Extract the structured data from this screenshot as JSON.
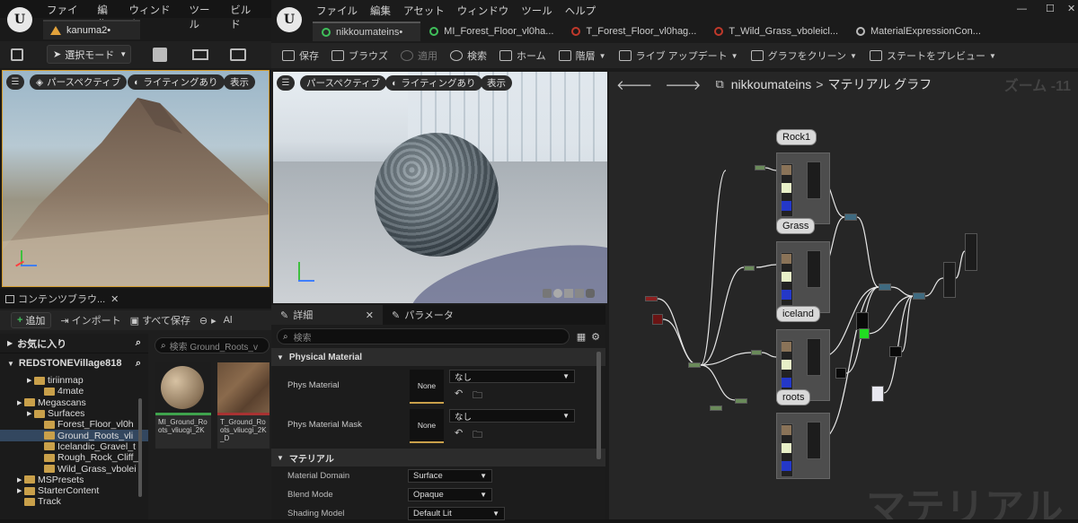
{
  "left_window": {
    "menu": [
      "ファイル",
      "編集",
      "ウィンドウ",
      "ツール",
      "ビルド"
    ],
    "tab_title": "kanuma2•",
    "toolbar": {
      "mode_label": "選択モード"
    },
    "viewport": {
      "perspective": "パースペクティブ",
      "lighting": "ライティングあり",
      "show": "表示"
    }
  },
  "content_browser": {
    "tab_label": "コンテンツブラウ...",
    "add_label": "追加",
    "import_label": "インポート",
    "save_all_label": "すべて保存",
    "path_label": "Al",
    "favorites_label": "お気に入り",
    "project_label": "REDSTONEVillage818",
    "search_placeholder": "検索 Ground_Roots_v",
    "tree": [
      {
        "label": "tiriinmap",
        "indent": 2,
        "selected": false
      },
      {
        "label": "4mate",
        "indent": 3,
        "selected": false
      },
      {
        "label": "Megascans",
        "indent": 1,
        "selected": false
      },
      {
        "label": "Surfaces",
        "indent": 2,
        "selected": false
      },
      {
        "label": "Forest_Floor_vl0h",
        "indent": 3,
        "selected": false
      },
      {
        "label": "Ground_Roots_vli",
        "indent": 3,
        "selected": true
      },
      {
        "label": "Icelandic_Gravel_t",
        "indent": 3,
        "selected": false
      },
      {
        "label": "Rough_Rock_Cliff_",
        "indent": 3,
        "selected": false
      },
      {
        "label": "Wild_Grass_vbolei",
        "indent": 3,
        "selected": false
      },
      {
        "label": "MSPresets",
        "indent": 1,
        "selected": false
      },
      {
        "label": "StarterContent",
        "indent": 1,
        "selected": false
      },
      {
        "label": "Track",
        "indent": 1,
        "selected": false
      }
    ],
    "assets": [
      {
        "name": "MI_Ground_Roots_vliucgi_2K",
        "color": "#3fa34d"
      },
      {
        "name": "T_Ground_Roots_vliucgi_2K_D",
        "color": "#a83232"
      }
    ]
  },
  "right_window": {
    "menu": [
      "ファイル",
      "編集",
      "アセット",
      "ウィンドウ",
      "ツール",
      "ヘルプ"
    ],
    "tabs": [
      {
        "label": "nikkoumateins•",
        "active": true,
        "icon": "material-icon",
        "color": "#3fbf5a"
      },
      {
        "label": "MI_Forest_Floor_vl0ha...",
        "active": false,
        "icon": "material-instance-icon",
        "color": "#3fbf5a"
      },
      {
        "label": "T_Forest_Floor_vl0hag...",
        "active": false,
        "icon": "texture-icon",
        "color": "#c0392b"
      },
      {
        "label": "T_Wild_Grass_vboleicl...",
        "active": false,
        "icon": "texture-icon",
        "color": "#c0392b"
      },
      {
        "label": "MaterialExpressionCon...",
        "active": false,
        "icon": "expression-icon",
        "color": "#bbbbbb"
      }
    ],
    "toolbar": [
      "保存",
      "ブラウズ",
      "適用",
      "検索",
      "ホーム",
      "階層",
      "ライブ アップデート",
      "グラフをクリーン",
      "ステートをプレビュー"
    ],
    "preview": {
      "perspective": "パースペクティブ",
      "lighting": "ライティングあり",
      "show": "表示"
    },
    "details": {
      "tab_details": "詳細",
      "tab_params": "パラメータ",
      "search_placeholder": "検索",
      "section_physical": "Physical Material",
      "phys_material_label": "Phys Material",
      "phys_material_mask_label": "Phys Material Mask",
      "none_thumb": "None",
      "none_value": "なし",
      "section_material": "マテリアル",
      "properties": [
        {
          "label": "Material Domain",
          "value": "Surface"
        },
        {
          "label": "Blend Mode",
          "value": "Opaque"
        },
        {
          "label": "Shading Model",
          "value": "Default Lit"
        }
      ]
    },
    "graph": {
      "breadcrumb_root": "nikkoumateins",
      "breadcrumb_sep": ">",
      "breadcrumb_leaf": "マテリアル グラフ",
      "zoom": "ズーム -11",
      "watermark": "マテリアル",
      "comments": [
        "Rock1",
        "Grass",
        "iceland",
        "roots"
      ]
    }
  }
}
